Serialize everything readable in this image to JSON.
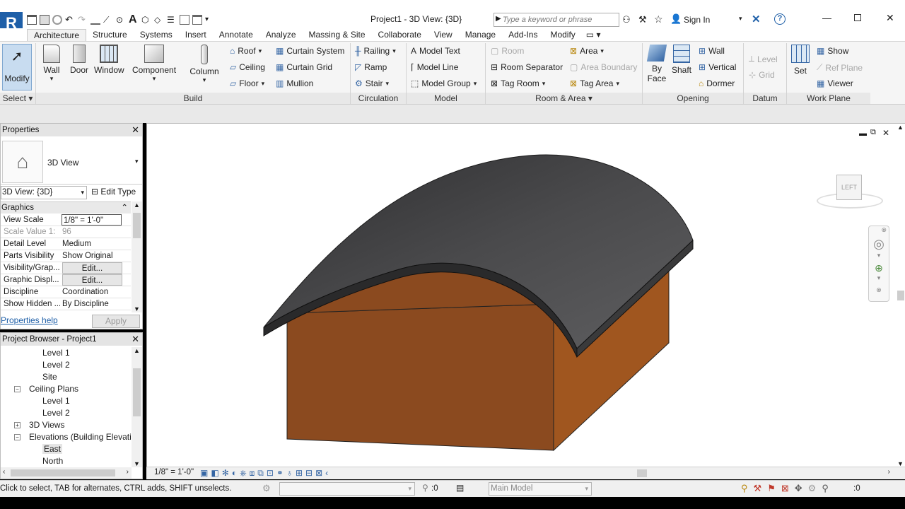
{
  "window": {
    "title": "Project1 - 3D View: {3D}",
    "search_placeholder": "Type a keyword or phrase",
    "sign_in": "Sign In"
  },
  "tabs": [
    "Architecture",
    "Structure",
    "Systems",
    "Insert",
    "Annotate",
    "Analyze",
    "Massing & Site",
    "Collaborate",
    "View",
    "Manage",
    "Add-Ins",
    "Modify"
  ],
  "ribbon": {
    "modify": "Modify",
    "select": "Select",
    "build": {
      "label": "Build",
      "wall": "Wall",
      "door": "Door",
      "window": "Window",
      "component": "Component",
      "column": "Column",
      "roof": "Roof",
      "ceiling": "Ceiling",
      "floor": "Floor",
      "curtain_system": "Curtain System",
      "curtain_grid": "Curtain Grid",
      "mullion": "Mullion"
    },
    "circulation": {
      "label": "Circulation",
      "railing": "Railing",
      "ramp": "Ramp",
      "stair": "Stair"
    },
    "model": {
      "label": "Model",
      "text": "Model Text",
      "line": "Model Line",
      "group": "Model Group"
    },
    "room_area": {
      "label": "Room & Area",
      "room": "Room",
      "room_separator": "Room Separator",
      "tag_room": "Tag Room",
      "area": "Area",
      "area_boundary": "Area Boundary",
      "tag_area": "Tag Area"
    },
    "opening": {
      "label": "Opening",
      "by_face": "By",
      "by_face2": "Face",
      "shaft": "Shaft",
      "wall": "Wall",
      "vertical": "Vertical",
      "dormer": "Dormer"
    },
    "datum": {
      "label": "Datum",
      "level": "Level",
      "grid": "Grid"
    },
    "work_plane": {
      "label": "Work Plane",
      "set": "Set",
      "show": "Show",
      "ref_plane": "Ref Plane",
      "viewer": "Viewer"
    }
  },
  "properties": {
    "title": "Properties",
    "type_name": "3D View",
    "selector": "3D View: {3D}",
    "edit_type": "Edit Type",
    "group": "Graphics",
    "rows": [
      {
        "k": "View Scale",
        "v": "1/8\" = 1'-0\""
      },
      {
        "k": "Scale Value    1:",
        "v": "96"
      },
      {
        "k": "Detail Level",
        "v": "Medium"
      },
      {
        "k": "Parts Visibility",
        "v": "Show Original"
      },
      {
        "k": "Visibility/Grap...",
        "v": "Edit..."
      },
      {
        "k": "Graphic Displ...",
        "v": "Edit..."
      },
      {
        "k": "Discipline",
        "v": "Coordination"
      },
      {
        "k": "Show Hidden ...",
        "v": "By Discipline"
      }
    ],
    "help": "Properties help",
    "apply": "Apply"
  },
  "browser": {
    "title": "Project Browser - Project1",
    "items": [
      {
        "label": "Level 1",
        "indent": 2
      },
      {
        "label": "Level 2",
        "indent": 2
      },
      {
        "label": "Site",
        "indent": 2
      },
      {
        "label": "Ceiling Plans",
        "indent": 1,
        "toggle": "−"
      },
      {
        "label": "Level 1",
        "indent": 2
      },
      {
        "label": "Level 2",
        "indent": 2
      },
      {
        "label": "3D Views",
        "indent": 1,
        "toggle": "+"
      },
      {
        "label": "Elevations (Building Elevation",
        "indent": 1,
        "toggle": "−"
      },
      {
        "label": "East",
        "indent": 2
      },
      {
        "label": "North",
        "indent": 2
      }
    ]
  },
  "viewport": {
    "scale": "1/8\" = 1'-0\"",
    "viewcube_face": "LEFT"
  },
  "status": {
    "hint": "Click to select, TAB for alternates, CTRL adds, SHIFT unselects.",
    "filter_count": ":0",
    "workset": "Main Model",
    "selection_count": ":0"
  },
  "colors": {
    "roof": "#3d3d3f",
    "wall": "#8b4a1f",
    "wall_side": "#a0561f",
    "accent": "#1e6fb5"
  }
}
